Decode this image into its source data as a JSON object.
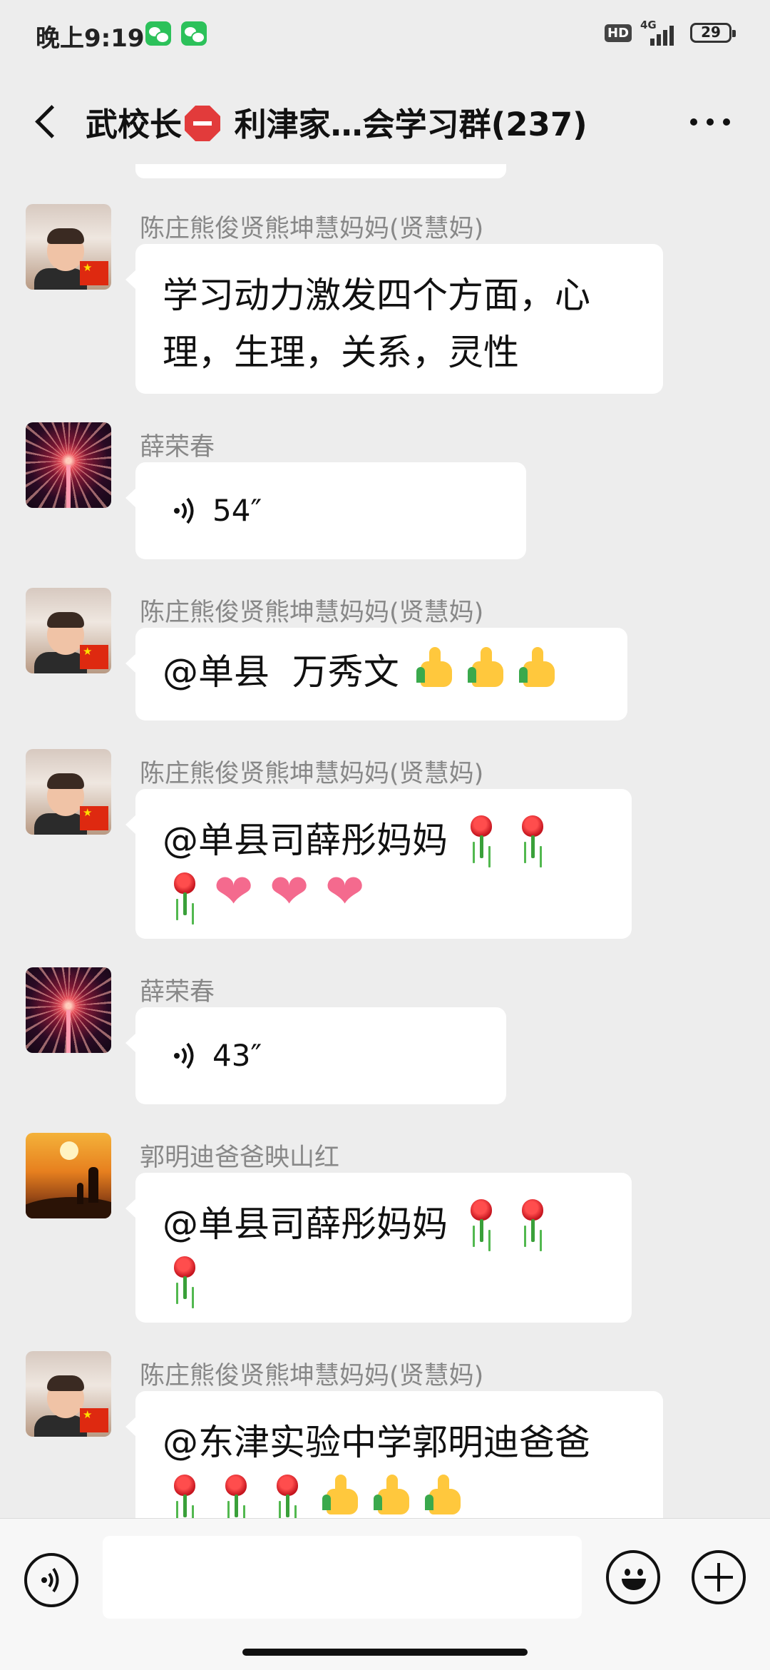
{
  "status_bar": {
    "time": "晚上9:19",
    "hd": "HD",
    "network": "4G",
    "battery": "29"
  },
  "header": {
    "title_part1": "武校长",
    "title_part2": " 利津家…会学习群(237)",
    "stop_icon": "stop-sign-emoji"
  },
  "messages": [
    {
      "sender": "陈庄熊俊贤熊坤慧妈妈(贤慧妈)",
      "avatar": "child-with-flag",
      "text": "学习动力激发四个方面，心理，生理，关系，灵性"
    },
    {
      "sender": "薛荣春",
      "avatar": "fireworks",
      "voice_duration": "54″"
    },
    {
      "sender": "陈庄熊俊贤熊坤慧妈妈(贤慧妈)",
      "avatar": "child-with-flag",
      "text": "@单县  万秀文 ",
      "emojis": [
        "thumbs-up",
        "thumbs-up",
        "thumbs-up"
      ]
    },
    {
      "sender": "陈庄熊俊贤熊坤慧妈妈(贤慧妈)",
      "avatar": "child-with-flag",
      "text": "@单县司薛彤妈妈 ",
      "emojis": [
        "rose",
        "rose",
        "rose",
        "heart",
        "heart",
        "heart"
      ]
    },
    {
      "sender": "薛荣春",
      "avatar": "fireworks",
      "voice_duration": "43″"
    },
    {
      "sender": "郭明迪爸爸映山红",
      "avatar": "sunset",
      "text": "@单县司薛彤妈妈 ",
      "emojis": [
        "rose",
        "rose",
        "rose"
      ]
    },
    {
      "sender": "陈庄熊俊贤熊坤慧妈妈(贤慧妈)",
      "avatar": "child-with-flag",
      "text": "@东津实验中学郭明迪爸爸",
      "emojis": [
        "rose",
        "rose",
        "rose",
        "thumbs-up",
        "thumbs-up",
        "thumbs-up"
      ]
    }
  ],
  "input_bar": {
    "voice_icon": "voice-input-icon",
    "emoji_icon": "smiley-icon",
    "plus_icon": "plus-icon"
  },
  "colors": {
    "background": "#ededed",
    "bubble": "#ffffff",
    "name": "#888888"
  }
}
